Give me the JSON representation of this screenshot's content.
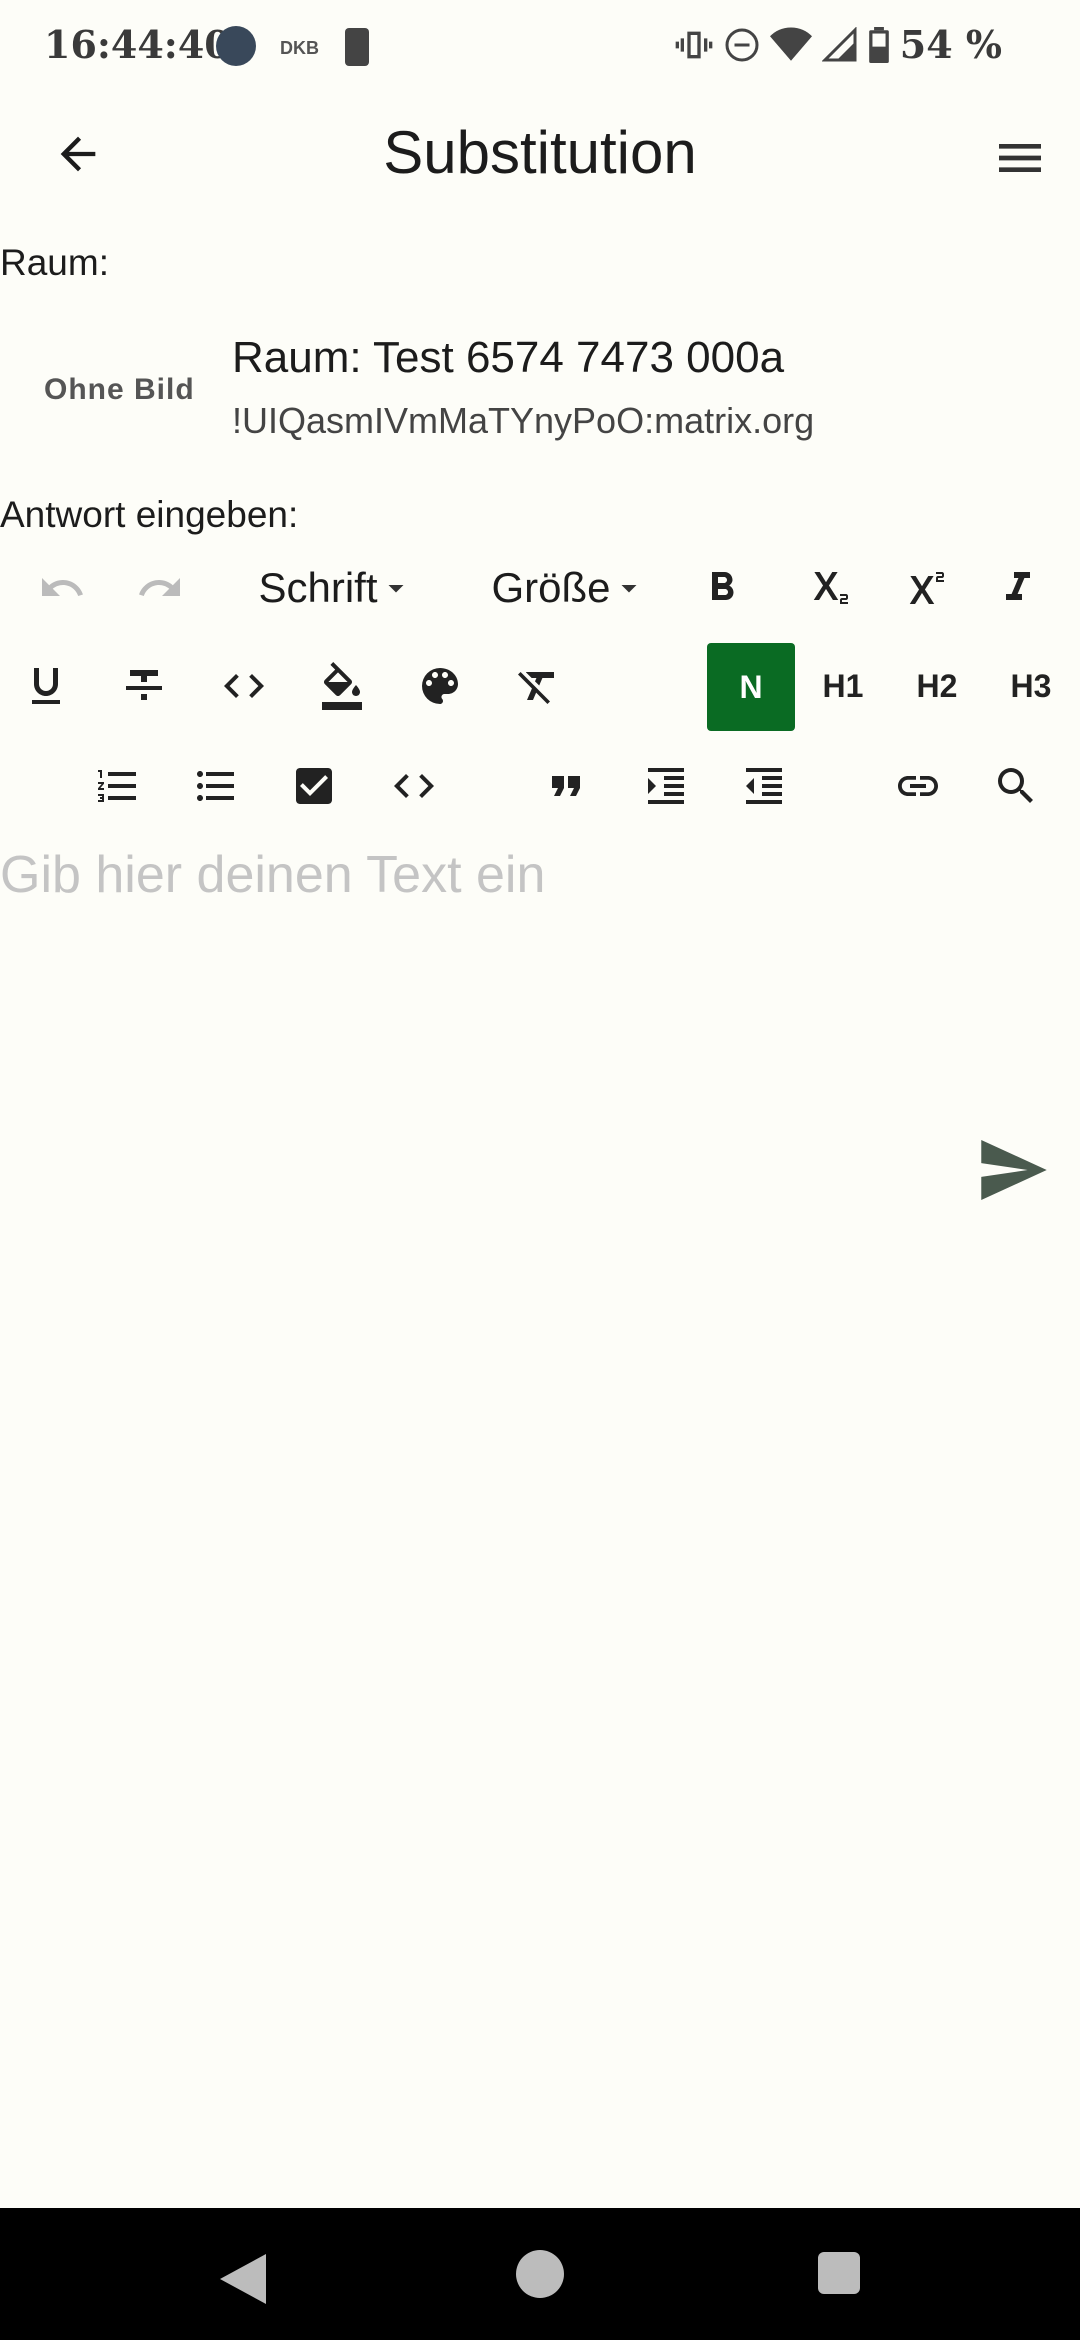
{
  "status_bar": {
    "time": "16:44:40",
    "notification_label": "DKB",
    "battery_text": "54 %"
  },
  "app_bar": {
    "title": "Substitution",
    "back_icon": "arrow-back-icon",
    "menu_icon": "hamburger-menu-icon"
  },
  "room": {
    "label": "Raum:",
    "avatar_placeholder": "Ohne Bild",
    "name": "Raum: Test 6574 7473 000a",
    "id": "!UIQasmIVmMaTYnyPoO:matrix.org"
  },
  "reply": {
    "label": "Antwort eingeben:",
    "placeholder": "Gib hier deinen Text ein"
  },
  "toolbar": {
    "font_dropdown": "Schrift",
    "size_dropdown": "Größe",
    "headings": [
      "N",
      "H1",
      "H2",
      "H3"
    ],
    "active_heading": "N",
    "accent_color": "#0a6b23",
    "row1_icons": [
      "undo-icon",
      "redo-icon",
      "bold-icon",
      "subscript-icon",
      "superscript-icon",
      "italic-icon"
    ],
    "row2_icons": [
      "underline-icon",
      "strikethrough-icon",
      "code-icon",
      "fill-color-icon",
      "palette-icon",
      "clear-format-icon"
    ],
    "row3_icons": [
      "numbered-list-icon",
      "bullet-list-icon",
      "checkbox-icon",
      "code-block-icon",
      "quote-icon",
      "indent-icon",
      "outdent-icon",
      "link-icon",
      "search-icon"
    ]
  },
  "send_icon": "send-icon",
  "nav_bar": {
    "icons": [
      "nav-back-icon",
      "nav-home-icon",
      "nav-recents-icon"
    ]
  }
}
